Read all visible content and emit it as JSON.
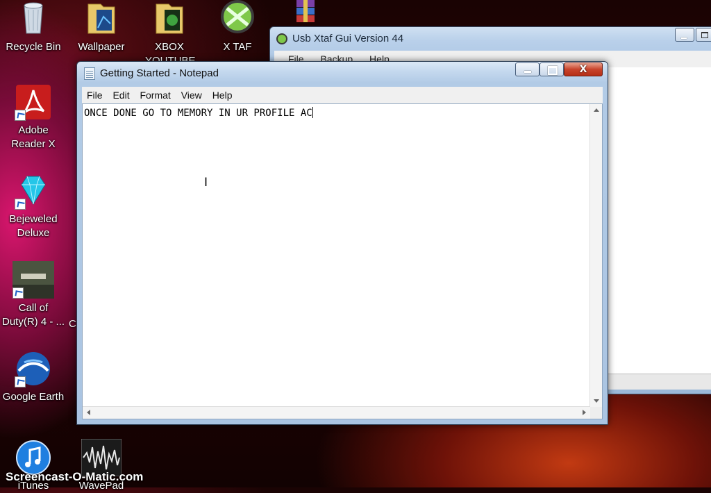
{
  "desktop": {
    "icons": [
      {
        "label": "Recycle Bin",
        "icon": "recycle-bin-icon"
      },
      {
        "label": "Wallpaper",
        "icon": "folder-icon"
      },
      {
        "label": "XBOX YOUTUBE",
        "icon": "folder-icon"
      },
      {
        "label": "X TAF",
        "icon": "xplorer-usb-icon"
      },
      {
        "label": "",
        "icon": "winrar-icon"
      },
      {
        "label": "Adobe Reader X",
        "icon": "adobe-reader-icon"
      },
      {
        "label": "Bejeweled Deluxe",
        "icon": "bejeweled-gem-icon"
      },
      {
        "label": "Call of Duty(R) 4 - ...",
        "icon": "call-of-duty-icon"
      },
      {
        "label": "Google Earth",
        "icon": "google-earth-icon"
      },
      {
        "label": "iTunes",
        "icon": "itunes-icon"
      },
      {
        "label": "WavePad",
        "icon": "wavepad-icon"
      }
    ],
    "stray_label": "C"
  },
  "xtaf_window": {
    "title": "Usb Xtaf Gui Version 44",
    "menu": [
      "File",
      "Backup",
      "Help"
    ]
  },
  "notepad": {
    "title": "Getting Started - Notepad",
    "menu": [
      "File",
      "Edit",
      "Format",
      "View",
      "Help"
    ],
    "content": "ONCE DONE GO TO MEMORY IN UR PROFILE AC",
    "close_glyph": "X"
  },
  "watermark": "Screencast-O-Matic.com",
  "colors": {
    "close": "#c8432b",
    "titlebar": "#b2cbe6",
    "icon_shortcut_arrow": "#1a5fc8"
  }
}
